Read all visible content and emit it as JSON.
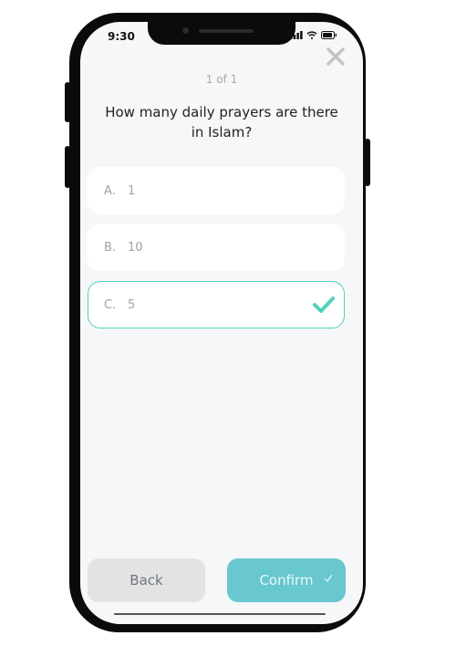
{
  "status_bar": {
    "time": "9:30"
  },
  "quiz": {
    "counter": "1 of 1",
    "question": "How many daily prayers are there in Islam?",
    "options": [
      {
        "letter": "A.",
        "value": "1",
        "selected": false
      },
      {
        "letter": "B.",
        "value": "10",
        "selected": false
      },
      {
        "letter": "C.",
        "value": "5",
        "selected": true
      }
    ]
  },
  "buttons": {
    "back": "Back",
    "confirm": "Confirm"
  },
  "colors": {
    "accent": "#4fd1bd",
    "confirm_bg": "#68c7cf",
    "back_bg": "#e2e3e4",
    "screen_bg": "#f6f7f8"
  },
  "icons": {
    "close": "close-icon",
    "selected": "checkmark-icon",
    "confirm": "small-check-icon"
  }
}
